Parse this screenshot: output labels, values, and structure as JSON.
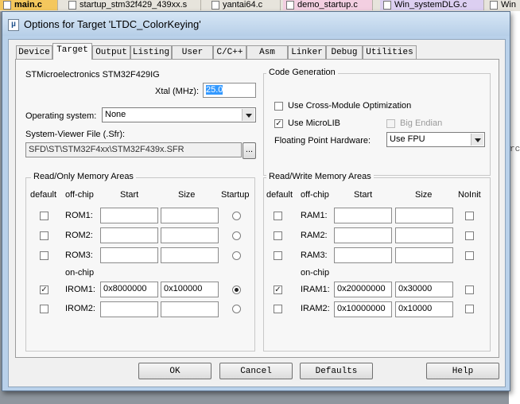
{
  "editor_tabs": [
    {
      "label": "main.c",
      "style": "active"
    },
    {
      "label": "startup_stm32f429_439xx.s",
      "style": "plain"
    },
    {
      "label": "yantai64.c",
      "style": "plain"
    },
    {
      "label": "demo_startup.c",
      "style": "pink"
    },
    {
      "label": "Win_systemDLG.c",
      "style": "violet"
    },
    {
      "label": "Win",
      "style": "plain"
    }
  ],
  "editor_fragment": "rcr",
  "dialog": {
    "title": "Options for Target 'LTDC_ColorKeying'",
    "title_icon": "µ",
    "tabs": [
      "Device",
      "Target",
      "Output",
      "Listing",
      "User",
      "C/C++",
      "Asm",
      "Linker",
      "Debug",
      "Utilities"
    ],
    "selected_tab": "Target",
    "device_name": "STMicroelectronics STM32F429IG",
    "xtal_label": "Xtal (MHz):",
    "xtal_value": "25.0",
    "os_label": "Operating system:",
    "os_value": "None",
    "sfr_label": "System-Viewer File (.Sfr):",
    "sfr_value": "SFD\\ST\\STM32F4xx\\STM32F439x.SFR",
    "sfr_browse": "...",
    "code_generation": {
      "title": "Code Generation",
      "cross_module_label": "Use Cross-Module Optimization",
      "cross_module_checked": false,
      "microlib_label": "Use MicroLIB",
      "microlib_checked": true,
      "big_endian_label": "Big Endian",
      "big_endian_checked": false,
      "fpu_label": "Floating Point Hardware:",
      "fpu_value": "Use FPU"
    },
    "ro_memory": {
      "title": "Read/Only Memory Areas",
      "col_default": "default",
      "col_offchip": "off-chip",
      "col_start": "Start",
      "col_size": "Size",
      "col_startup": "Startup",
      "onchip_label": "on-chip",
      "rows": [
        {
          "name": "ROM1:",
          "start": "",
          "size": "",
          "default": false,
          "startup": false
        },
        {
          "name": "ROM2:",
          "start": "",
          "size": "",
          "default": false,
          "startup": false
        },
        {
          "name": "ROM3:",
          "start": "",
          "size": "",
          "default": false,
          "startup": false
        },
        {
          "name": "IROM1:",
          "start": "0x8000000",
          "size": "0x100000",
          "default": true,
          "startup": true
        },
        {
          "name": "IROM2:",
          "start": "",
          "size": "",
          "default": false,
          "startup": false
        }
      ]
    },
    "rw_memory": {
      "title": "Read/Write Memory Areas",
      "col_default": "default",
      "col_offchip": "off-chip",
      "col_start": "Start",
      "col_size": "Size",
      "col_noinit": "NoInit",
      "onchip_label": "on-chip",
      "rows": [
        {
          "name": "RAM1:",
          "start": "",
          "size": "",
          "default": false,
          "noinit": false
        },
        {
          "name": "RAM2:",
          "start": "",
          "size": "",
          "default": false,
          "noinit": false
        },
        {
          "name": "RAM3:",
          "start": "",
          "size": "",
          "default": false,
          "noinit": false
        },
        {
          "name": "IRAM1:",
          "start": "0x20000000",
          "size": "0x30000",
          "default": true,
          "noinit": false
        },
        {
          "name": "IRAM2:",
          "start": "0x10000000",
          "size": "0x10000",
          "default": false,
          "noinit": false
        }
      ]
    },
    "buttons": {
      "ok": "OK",
      "cancel": "Cancel",
      "defaults": "Defaults",
      "help": "Help"
    }
  }
}
